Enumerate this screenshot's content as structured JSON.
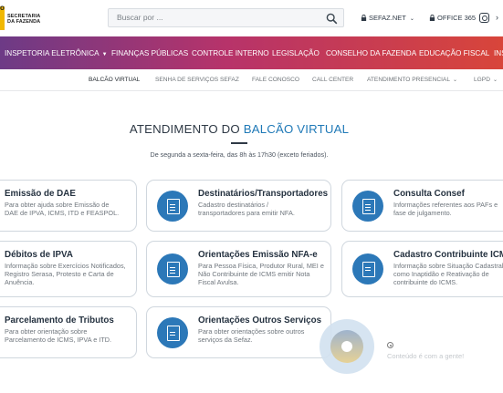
{
  "header": {
    "logo_letter": "o",
    "logo_line1": "SECRETARIA",
    "logo_line2": "DA FAZENDA",
    "search_placeholder": "Buscar por ...",
    "sefaz_net": "SEFAZ.NET",
    "office365": "OFFICE 365"
  },
  "main_nav": [
    {
      "label": "INSPETORIA ELETRÔNICA",
      "has_dropdown": true
    },
    {
      "label": "FINANÇAS PÚBLICAS",
      "has_dropdown": false
    },
    {
      "label": "CONTROLE INTERNO",
      "has_dropdown": false
    },
    {
      "label": "LEGISLAÇÃO",
      "has_dropdown": false
    },
    {
      "label": "CONSELHO DA FAZENDA",
      "has_dropdown": false
    },
    {
      "label": "EDUCAÇÃO FISCAL",
      "has_dropdown": false
    },
    {
      "label": "INS",
      "has_dropdown": false
    }
  ],
  "sub_nav": [
    {
      "label": "BALCÃO VIRTUAL",
      "active": true
    },
    {
      "label": "SENHA DE SERVIÇOS SEFAZ",
      "active": false
    },
    {
      "label": "FALE CONOSCO",
      "active": false
    },
    {
      "label": "CALL CENTER",
      "active": false
    },
    {
      "label": "ATENDIMENTO PRESENCIAL",
      "active": false
    },
    {
      "label": "LGPD",
      "active": false
    }
  ],
  "page": {
    "title_prefix": "ATENDIMENTO DO ",
    "title_highlight": "BALCÃO VIRTUAL",
    "subtitle": "De segunda a sexta-feira, das 8h às 17h30 (exceto feriados)."
  },
  "cards": [
    {
      "title": "Emissão de DAE",
      "desc": "Para obter ajuda sobre Emissão de DAE de IPVA, ICMS, ITD e FEASPOL.",
      "icon": "document-icon"
    },
    {
      "title": "Destinatários/Transportadores",
      "desc": "Cadastro destinatários / transportadores para emitir NFA.",
      "icon": "document-icon"
    },
    {
      "title": "Consulta Consef",
      "desc": "Informações referentes aos PAFs e fase de julgamento.",
      "icon": "document-icon"
    },
    {
      "title": "Débitos de IPVA",
      "desc": "Informação sobre Exercícios Notificados, Registro Serasa, Protesto e Carta de Anuência.",
      "icon": "car-document-icon"
    },
    {
      "title": "Orientações Emissão NFA-e",
      "desc": "Para Pessoa Física, Produtor Rural, MEI e Não Contribuinte de ICMS emitir Nota Fiscal Avulsa.",
      "icon": "document-icon"
    },
    {
      "title": "Cadastro Contribuinte ICMS",
      "desc": "Informação sobre Situação Cadastral como Inaptidão e Reativação de contribuinte do ICMS.",
      "icon": "archive-box-icon"
    },
    {
      "title": "Parcelamento de Tributos",
      "desc": "Para obter orientação sobre Parcelamento de ICMS, IPVA e ITD.",
      "icon": "document-icon"
    },
    {
      "title": "Orientações Outros Serviços",
      "desc": "Para obter orientações sobre outros serviços da Sefaz.",
      "icon": "chat-icon"
    }
  ],
  "cookie_text": "Conteúdo é com a gente!"
}
